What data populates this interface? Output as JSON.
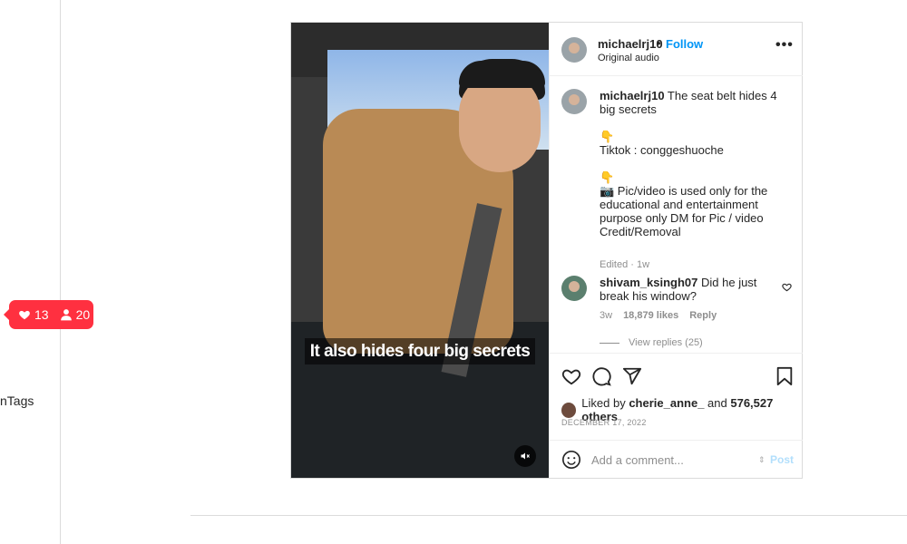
{
  "sidebar": {
    "partial_label": "nTags"
  },
  "notification": {
    "likes": "13",
    "followers": "20"
  },
  "post": {
    "video": {
      "caption_overlay": "It also hides four big secrets"
    },
    "header": {
      "username": "michaelrj10",
      "separator": "•",
      "follow_label": "Follow",
      "audio": "Original audio",
      "more": "•••"
    },
    "caption": {
      "username": "michaelrj10",
      "text": " The seat belt hides 4 big secrets\n\n👇\nTiktok : conggeshuoche\n\n👇\n📷 Pic/video is used only for the educational and entertainment purpose only DM for Pic / video Credit/Removal",
      "meta": "Edited · 1w"
    },
    "comment": {
      "username": "shivam_ksingh07",
      "text": " Did he just break his window?",
      "age": "3w",
      "likes": "18,879 likes",
      "reply_label": "Reply",
      "view_replies": "View replies (25)"
    },
    "liked_by": {
      "prefix": "Liked by ",
      "user": "cherie_anne_",
      "middle": " and ",
      "count": "576,527 others"
    },
    "date": "DECEMBER 17, 2022",
    "add_comment": {
      "placeholder": "Add a comment...",
      "post_label": "Post"
    }
  }
}
